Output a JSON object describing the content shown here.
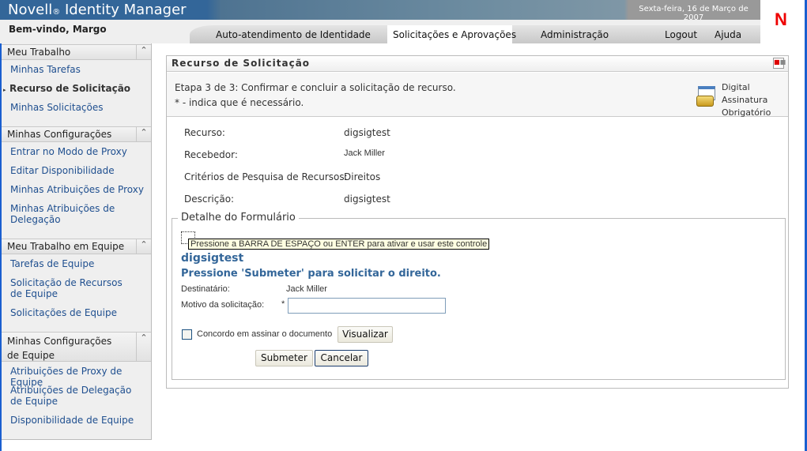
{
  "header": {
    "app_title": "Novell",
    "reg": "®",
    "app_title_rest": " Identity Manager",
    "date": "Sexta-feira, 16 de Março de 2007",
    "logo": "N",
    "welcome": "Bem-vindo, Margo"
  },
  "tabs": [
    "Auto-atendimento de Identidade",
    "Solicitações e Aprovações",
    "Administração",
    "Logout",
    "Ajuda"
  ],
  "sidebar": [
    {
      "title": "Meu Trabalho",
      "items": [
        "Minhas Tarefas",
        "Recurso de Solicitação",
        "Minhas Solicitações"
      ]
    },
    {
      "title": "Minhas Configurações",
      "items": [
        "Entrar no Modo de Proxy",
        "Editar Disponibilidade",
        "Minhas Atribuições de Proxy",
        "Minhas Atribuições de Delegação"
      ]
    },
    {
      "title": "Meu Trabalho em Equipe",
      "items": [
        "Tarefas de Equipe",
        "Solicitação de Recursos de Equipe",
        "Solicitações de Equipe"
      ]
    },
    {
      "title": "Minhas Configurações de Equipe",
      "items": [
        "Atribuições de Proxy de Equipe",
        "Atribuições de Delegação de Equipe",
        "Disponibilidade de Equipe"
      ]
    }
  ],
  "panel": {
    "title": "Recurso de Solicitação",
    "step": "Etapa 3 de 3: Confirmar e concluir a solicitação de recurso.",
    "required_note": "* - indica que é necessário.",
    "digsig": [
      "Digital",
      "Assinatura",
      "Obrigatório"
    ],
    "fields": [
      {
        "label": "Recurso:",
        "value": "digsigtest"
      },
      {
        "label": "Recebedor:",
        "value": "Jack Miller"
      },
      {
        "label": "Critérios de Pesquisa de Recursos:",
        "value": "Direitos"
      },
      {
        "label": "Descrição:",
        "value": "digsigtest"
      }
    ]
  },
  "form": {
    "legend": "Detalhe do Formulário",
    "tooltip": "Pressione a BARRA DE ESPAÇO ou ENTER para ativar e usar este controle",
    "name": "digsigtest",
    "instruction": "Pressione 'Submeter' para solicitar o direito.",
    "recipient_label": "Destinatário:",
    "recipient_value": "Jack Miller",
    "reason_label": "Motivo da solicitação:",
    "required_mark": "*",
    "reason_value": "",
    "agree_label": "Concordo em assinar o documento",
    "view_btn": "Visualizar",
    "submit_btn": "Submeter",
    "cancel_btn": "Cancelar"
  }
}
